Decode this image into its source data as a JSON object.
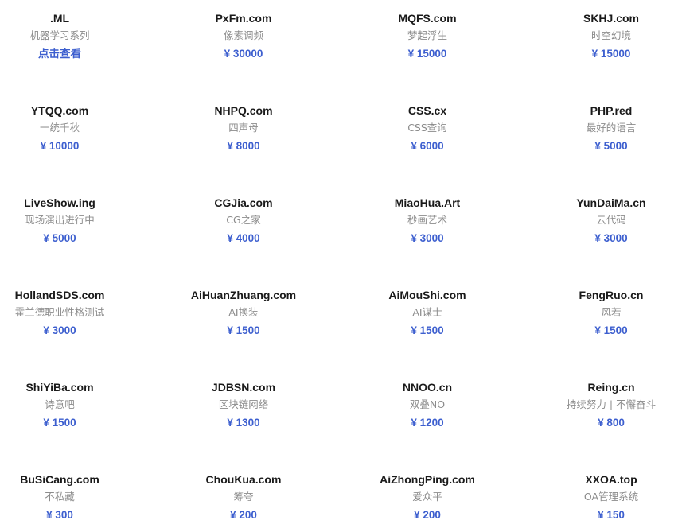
{
  "colors": {
    "domain_text": "#1a1a1a",
    "description_text": "#8c8c8c",
    "price_text": "#3d5fcf",
    "background": "#ffffff"
  },
  "listings": [
    {
      "domain": ".ML",
      "description": "机器学习系列",
      "price": "点击查看"
    },
    {
      "domain": "PxFm.com",
      "description": "像素调频",
      "price": "¥ 30000"
    },
    {
      "domain": "MQFS.com",
      "description": "梦起浮生",
      "price": "¥ 15000"
    },
    {
      "domain": "SKHJ.com",
      "description": "时空幻境",
      "price": "¥ 15000"
    },
    {
      "domain": "YTQQ.com",
      "description": "一统千秋",
      "price": "¥ 10000"
    },
    {
      "domain": "NHPQ.com",
      "description": "四声母",
      "price": "¥ 8000"
    },
    {
      "domain": "CSS.cx",
      "description": "CSS查询",
      "price": "¥ 6000"
    },
    {
      "domain": "PHP.red",
      "description": "最好的语言",
      "price": "¥ 5000"
    },
    {
      "domain": "LiveShow.ing",
      "description": "现场演出进行中",
      "price": "¥ 5000"
    },
    {
      "domain": "CGJia.com",
      "description": "CG之家",
      "price": "¥ 4000"
    },
    {
      "domain": "MiaoHua.Art",
      "description": "秒画艺术",
      "price": "¥ 3000"
    },
    {
      "domain": "YunDaiMa.cn",
      "description": "云代码",
      "price": "¥ 3000"
    },
    {
      "domain": "HollandSDS.com",
      "description": "霍兰德职业性格测试",
      "price": "¥ 3000"
    },
    {
      "domain": "AiHuanZhuang.com",
      "description": "AI换装",
      "price": "¥ 1500"
    },
    {
      "domain": "AiMouShi.com",
      "description": "AI谋士",
      "price": "¥ 1500"
    },
    {
      "domain": "FengRuo.cn",
      "description": "风若",
      "price": "¥ 1500"
    },
    {
      "domain": "ShiYiBa.com",
      "description": "诗意吧",
      "price": "¥ 1500"
    },
    {
      "domain": "JDBSN.com",
      "description": "区块链网络",
      "price": "¥ 1300"
    },
    {
      "domain": "NNOO.cn",
      "description": "双叠NO",
      "price": "¥ 1200"
    },
    {
      "domain": "Reing.cn",
      "description": "持续努力 | 不懈奋斗",
      "price": "¥ 800"
    },
    {
      "domain": "BuSiCang.com",
      "description": "不私藏",
      "price": "¥ 300"
    },
    {
      "domain": "ChouKua.com",
      "description": "筹夸",
      "price": "¥ 200"
    },
    {
      "domain": "AiZhongPing.com",
      "description": "爱众平",
      "price": "¥ 200"
    },
    {
      "domain": "XXOA.top",
      "description": "OA管理系统",
      "price": "¥ 150"
    }
  ]
}
